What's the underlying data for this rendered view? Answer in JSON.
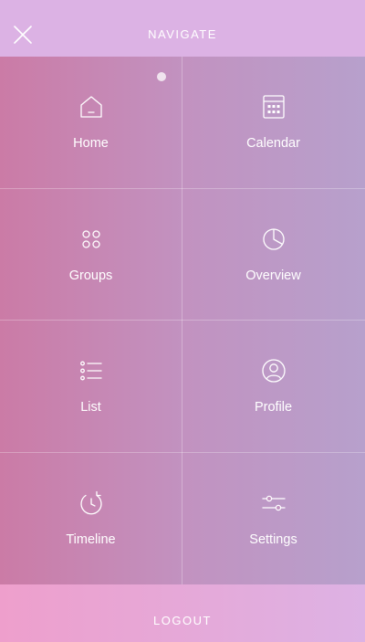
{
  "header": {
    "title": "NAVIGATE",
    "close_icon": "close-icon"
  },
  "menu": {
    "items": [
      {
        "label": "Home",
        "icon": "home-icon"
      },
      {
        "label": "Calendar",
        "icon": "calendar-icon"
      },
      {
        "label": "Groups",
        "icon": "groups-icon"
      },
      {
        "label": "Overview",
        "icon": "pie-chart-icon"
      },
      {
        "label": "List",
        "icon": "list-icon"
      },
      {
        "label": "Profile",
        "icon": "profile-icon"
      },
      {
        "label": "Timeline",
        "icon": "timeline-icon"
      },
      {
        "label": "Settings",
        "icon": "sliders-icon"
      }
    ]
  },
  "footer": {
    "logout_label": "LOGOUT"
  },
  "colors": {
    "header_bg": "#dcb2e4",
    "grid_left": "#cb7ba6",
    "grid_right": "#b7a0cc",
    "footer_left": "#ee9fcc",
    "footer_right": "#ddb2e4",
    "text": "#ffffff"
  }
}
